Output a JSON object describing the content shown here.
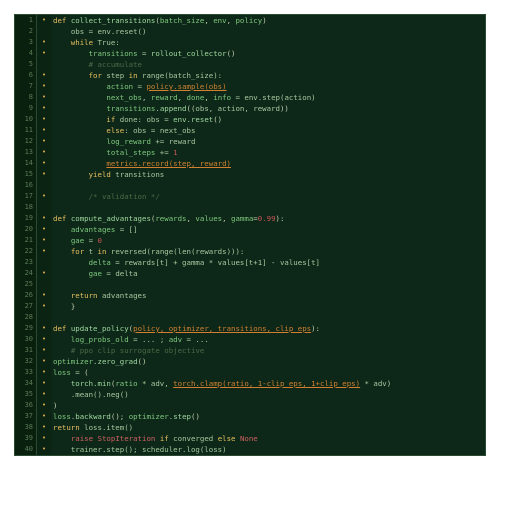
{
  "editor": {
    "theme": "dark-green",
    "lines": [
      {
        "num": "1",
        "mark": "•",
        "segments": [
          [
            "kw",
            "def "
          ],
          [
            "func",
            "collect_transitions"
          ],
          [
            "punct",
            "("
          ],
          [
            "var",
            "batch_size"
          ],
          [
            "punct",
            ", "
          ],
          [
            "var",
            "env"
          ],
          [
            "punct",
            ", "
          ],
          [
            "var",
            "policy"
          ],
          [
            "punct",
            ")"
          ]
        ]
      },
      {
        "num": "2",
        "mark": "",
        "segments": [
          [
            "punct",
            "    "
          ],
          [
            "plain",
            "obs = env.reset()"
          ]
        ]
      },
      {
        "num": "3",
        "mark": "•",
        "segments": [
          [
            "kw",
            "    while"
          ],
          [
            "plain",
            " True:"
          ]
        ]
      },
      {
        "num": "4",
        "mark": "•",
        "segments": [
          [
            "punct",
            "        "
          ],
          [
            "var",
            "transitions"
          ],
          [
            "plain",
            " = "
          ],
          [
            "func",
            "rollout_collector"
          ],
          [
            "punct",
            "()"
          ]
        ]
      },
      {
        "num": "5",
        "mark": "",
        "segments": [
          [
            "punct",
            "        "
          ],
          [
            "comment",
            "# accumulate"
          ]
        ]
      },
      {
        "num": "6",
        "mark": "•",
        "segments": [
          [
            "kw",
            "        for"
          ],
          [
            "plain",
            " step "
          ],
          [
            "kw",
            "in"
          ],
          [
            "plain",
            " range(batch_size):"
          ]
        ]
      },
      {
        "num": "7",
        "mark": "•",
        "segments": [
          [
            "punct",
            "            "
          ],
          [
            "var",
            "action"
          ],
          [
            "plain",
            " = "
          ],
          [
            "highlight",
            "policy.sample(obs)"
          ]
        ]
      },
      {
        "num": "8",
        "mark": "•",
        "segments": [
          [
            "punct",
            "            "
          ],
          [
            "var",
            "next_obs"
          ],
          [
            "punct",
            ", "
          ],
          [
            "var",
            "reward"
          ],
          [
            "punct",
            ", "
          ],
          [
            "var",
            "done"
          ],
          [
            "punct",
            ", "
          ],
          [
            "var",
            "info"
          ],
          [
            "plain",
            " = env.step(action)"
          ]
        ]
      },
      {
        "num": "9",
        "mark": "•",
        "segments": [
          [
            "punct",
            "            "
          ],
          [
            "var",
            "transitions"
          ],
          [
            "plain",
            "."
          ],
          [
            "func",
            "append"
          ],
          [
            "punct",
            "(("
          ],
          [
            "plain",
            "obs, action, reward"
          ],
          [
            "punct",
            "))"
          ]
        ]
      },
      {
        "num": "10",
        "mark": "•",
        "segments": [
          [
            "punct",
            "            "
          ],
          [
            "kw",
            "if"
          ],
          [
            "plain",
            " done: obs = "
          ],
          [
            "func",
            "env.reset"
          ],
          [
            "punct",
            "()"
          ]
        ]
      },
      {
        "num": "11",
        "mark": "•",
        "segments": [
          [
            "punct",
            "            "
          ],
          [
            "kw",
            "else"
          ],
          [
            "plain",
            ": obs = next_obs"
          ]
        ]
      },
      {
        "num": "12",
        "mark": "•",
        "segments": [
          [
            "punct",
            "            "
          ],
          [
            "var",
            "log_reward"
          ],
          [
            "plain",
            " += reward"
          ]
        ]
      },
      {
        "num": "13",
        "mark": "•",
        "segments": [
          [
            "punct",
            "            "
          ],
          [
            "var",
            "total_steps"
          ],
          [
            "plain",
            " += "
          ],
          [
            "num",
            "1"
          ]
        ]
      },
      {
        "num": "14",
        "mark": "•",
        "segments": [
          [
            "punct",
            "            "
          ],
          [
            "highlight",
            "metrics.record(step, reward)"
          ]
        ]
      },
      {
        "num": "15",
        "mark": "•",
        "segments": [
          [
            "punct",
            "        "
          ],
          [
            "kw",
            "yield"
          ],
          [
            "plain",
            " transitions"
          ]
        ]
      },
      {
        "num": "16",
        "mark": "",
        "segments": []
      },
      {
        "num": "17",
        "mark": "•",
        "segments": [
          [
            "punct",
            "        "
          ],
          [
            "comment",
            "/* validation */"
          ]
        ]
      },
      {
        "num": "18",
        "mark": "",
        "segments": []
      },
      {
        "num": "19",
        "mark": "•",
        "segments": [
          [
            "kw",
            "def "
          ],
          [
            "func",
            "compute_advantages"
          ],
          [
            "punct",
            "("
          ],
          [
            "var",
            "rewards"
          ],
          [
            "punct",
            ", "
          ],
          [
            "var",
            "values"
          ],
          [
            "punct",
            ", "
          ],
          [
            "var",
            "gamma"
          ],
          [
            "punct",
            "="
          ],
          [
            "num",
            "0.99"
          ],
          [
            "punct",
            "):"
          ]
        ]
      },
      {
        "num": "20",
        "mark": "•",
        "segments": [
          [
            "punct",
            "    "
          ],
          [
            "var",
            "advantages"
          ],
          [
            "plain",
            " = []"
          ]
        ]
      },
      {
        "num": "21",
        "mark": "•",
        "segments": [
          [
            "punct",
            "    "
          ],
          [
            "var",
            "gae"
          ],
          [
            "plain",
            " = "
          ],
          [
            "num",
            "0"
          ]
        ]
      },
      {
        "num": "22",
        "mark": "•",
        "segments": [
          [
            "punct",
            "    "
          ],
          [
            "kw",
            "for"
          ],
          [
            "plain",
            " t "
          ],
          [
            "kw",
            "in"
          ],
          [
            "plain",
            " reversed(range(len(rewards))):"
          ]
        ]
      },
      {
        "num": "23",
        "mark": "",
        "segments": [
          [
            "punct",
            "        "
          ],
          [
            "var",
            "delta"
          ],
          [
            "plain",
            " = rewards[t] + gamma * values[t+1] - values[t]"
          ]
        ]
      },
      {
        "num": "24",
        "mark": "•",
        "segments": [
          [
            "punct",
            "        "
          ],
          [
            "var",
            "gae"
          ],
          [
            "plain",
            " = delta"
          ]
        ]
      },
      {
        "num": "25",
        "mark": "",
        "segments": []
      },
      {
        "num": "26",
        "mark": "•",
        "segments": [
          [
            "punct",
            "    "
          ],
          [
            "kw",
            "return"
          ],
          [
            "plain",
            " advantages"
          ]
        ]
      },
      {
        "num": "27",
        "mark": "•",
        "segments": [
          [
            "punct",
            "    "
          ],
          [
            "punct",
            "}"
          ]
        ]
      },
      {
        "num": "28",
        "mark": "",
        "segments": []
      },
      {
        "num": "29",
        "mark": "•",
        "segments": [
          [
            "kw",
            "def "
          ],
          [
            "func",
            "update_policy"
          ],
          [
            "punct",
            "("
          ],
          [
            "highlight",
            "policy, optimizer, transitions, clip_eps"
          ],
          [
            "punct",
            "):"
          ]
        ]
      },
      {
        "num": "30",
        "mark": "•",
        "segments": [
          [
            "punct",
            "    "
          ],
          [
            "var",
            "log_probs_old"
          ],
          [
            "plain",
            " = ... ; "
          ],
          [
            "var",
            "adv"
          ],
          [
            "plain",
            " = ..."
          ]
        ]
      },
      {
        "num": "31",
        "mark": "•",
        "segments": [
          [
            "punct",
            "    "
          ],
          [
            "comment",
            "# ppo clip surrogate objective"
          ]
        ]
      },
      {
        "num": "32",
        "mark": "•",
        "segments": [
          [
            "var",
            "optimizer"
          ],
          [
            "plain",
            "."
          ],
          [
            "func",
            "zero_grad"
          ],
          [
            "punct",
            "()"
          ]
        ]
      },
      {
        "num": "33",
        "mark": "•",
        "segments": [
          [
            "var",
            "loss"
          ],
          [
            "plain",
            " = "
          ],
          [
            "punct",
            "("
          ]
        ]
      },
      {
        "num": "34",
        "mark": "•",
        "segments": [
          [
            "punct",
            "    "
          ],
          [
            "func",
            "torch.min"
          ],
          [
            "punct",
            "("
          ],
          [
            "var",
            "ratio"
          ],
          [
            "plain",
            " * adv, "
          ],
          [
            "highlight",
            "torch.clamp(ratio, 1-clip_eps, 1+clip_eps)"
          ],
          [
            "plain",
            " * adv"
          ],
          [
            "punct",
            ")"
          ]
        ]
      },
      {
        "num": "35",
        "mark": "•",
        "segments": [
          [
            "punct",
            "    "
          ],
          [
            "plain",
            ".mean().neg()"
          ]
        ]
      },
      {
        "num": "36",
        "mark": "•",
        "segments": [
          [
            "punct",
            ")"
          ]
        ]
      },
      {
        "num": "37",
        "mark": "•",
        "segments": [
          [
            "var",
            "loss"
          ],
          [
            "plain",
            "."
          ],
          [
            "func",
            "backward"
          ],
          [
            "punct",
            "(); "
          ],
          [
            "var",
            "optimizer"
          ],
          [
            "plain",
            "."
          ],
          [
            "func",
            "step"
          ],
          [
            "punct",
            "()"
          ]
        ]
      },
      {
        "num": "38",
        "mark": "•",
        "segments": [
          [
            "kw",
            "return"
          ],
          [
            "plain",
            " loss.item()"
          ]
        ]
      },
      {
        "num": "39",
        "mark": "•",
        "segments": [
          [
            "punct",
            "    "
          ],
          [
            "kw2",
            "raise"
          ],
          [
            "plain",
            " "
          ],
          [
            "kw2",
            "StopIteration"
          ],
          [
            "plain",
            " "
          ],
          [
            "kw",
            "if"
          ],
          [
            "plain",
            " converged "
          ],
          [
            "kw",
            "else"
          ],
          [
            "plain",
            " "
          ],
          [
            "kw2",
            "None"
          ]
        ]
      },
      {
        "num": "40",
        "mark": "•",
        "segments": [
          [
            "punct",
            "    "
          ],
          [
            "plain",
            "trainer.step(); scheduler.log(loss)"
          ]
        ]
      }
    ]
  }
}
